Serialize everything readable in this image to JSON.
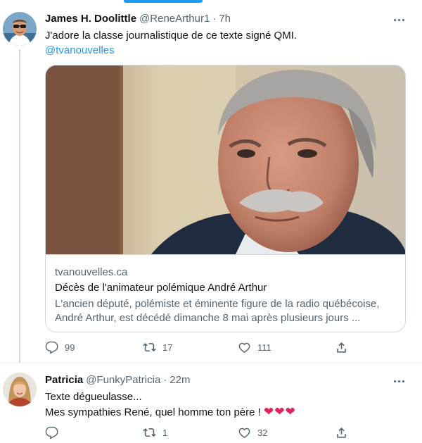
{
  "tweets": [
    {
      "author": {
        "name": "James H. Doolittle",
        "handle": "@ReneArthur1",
        "time": "7h"
      },
      "text": "J'adore la classe journalistique de ce texte signé QMI.",
      "mention": "@tvanouvelles",
      "card": {
        "domain": "tvanouvelles.ca",
        "title": "Décès de l'animateur polémique André Arthur",
        "description_line1": "L'ancien député, polémiste et éminente figure de la radio québécoise,",
        "description_line2": "André Arthur, est décédé dimanche 8 mai après plusieurs jours ..."
      },
      "actions": {
        "replies": "99",
        "retweets": "17",
        "likes": "111"
      }
    },
    {
      "author": {
        "name": "Patricia",
        "handle": "@FunkyPatricia",
        "time": "22m"
      },
      "text_line1": "Texte dégueulasse...",
      "text_line2": "Mes sympathies René, quel homme ton père !",
      "hearts": "❤❤❤",
      "actions": {
        "replies": "",
        "retweets": "1",
        "likes": "32"
      }
    }
  ],
  "icons": {
    "reply": "reply-icon",
    "retweet": "retweet-icon",
    "like": "like-icon",
    "share": "share-icon",
    "more": "more-icon"
  },
  "colors": {
    "accent": "#1d9bf0",
    "text": "#0f1419",
    "secondary": "#536471",
    "border": "#cfd9de",
    "heart": "#e0245e"
  }
}
